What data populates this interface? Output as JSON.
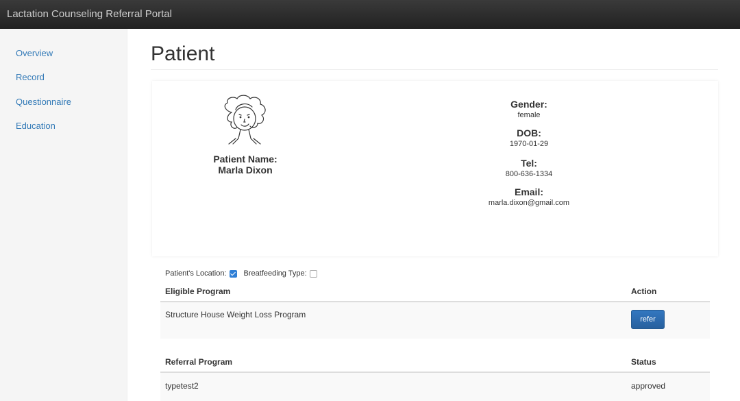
{
  "app": {
    "title": "Lactation Counseling Referral Portal"
  },
  "sidebar": {
    "items": [
      {
        "label": "Overview"
      },
      {
        "label": "Record"
      },
      {
        "label": "Questionnaire"
      },
      {
        "label": "Education"
      }
    ]
  },
  "page": {
    "title": "Patient"
  },
  "patient": {
    "name_label": "Patient Name:",
    "name": "Marla Dixon",
    "avatar_icon": "cartoon-woman-avatar",
    "fields": [
      {
        "label": "Gender:",
        "value": "female"
      },
      {
        "label": "DOB:",
        "value": "1970-01-29"
      },
      {
        "label": "Tel:",
        "value": "800-636-1334"
      },
      {
        "label": "Email:",
        "value": "marla.dixon@gmail.com"
      }
    ]
  },
  "filters": {
    "location_label": "Patient's Location:",
    "location_checked": true,
    "feeding_label": "Breatfeeding Type:",
    "feeding_checked": false
  },
  "eligible": {
    "headers": [
      "Eligible Program",
      "Action"
    ],
    "rows": [
      {
        "program": "Structure House Weight Loss Program",
        "action": "refer"
      }
    ]
  },
  "referral": {
    "headers": [
      "Referral Program",
      "Status"
    ],
    "rows": [
      {
        "program": "typetest2",
        "status": "approved"
      }
    ]
  },
  "colors": {
    "accent": "#337ab7",
    "navbar": "#2a2a2a",
    "button": "#2f6db0"
  }
}
